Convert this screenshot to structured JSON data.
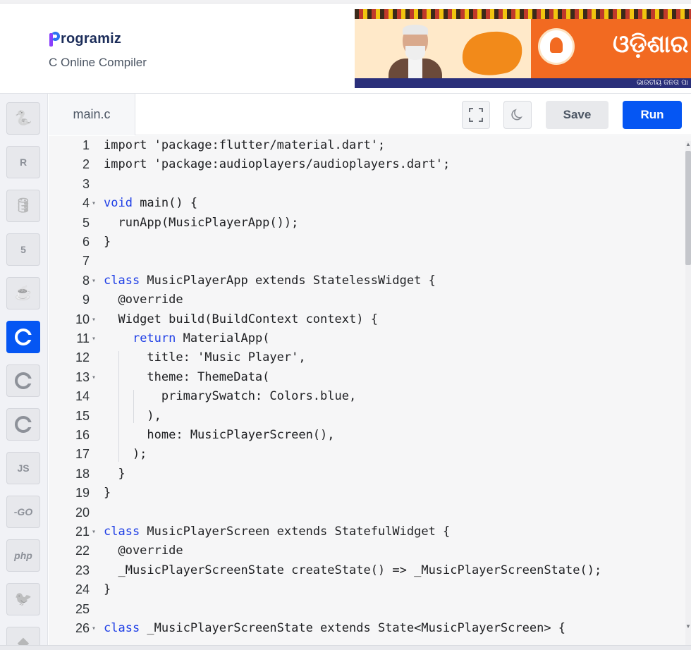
{
  "brand": {
    "name": "Programiz",
    "first_letter": "P",
    "rest": "rogramiz",
    "subtitle": "C Online Compiler"
  },
  "ad": {
    "headline": "ଓଡ଼ିଶାର",
    "footer": "ଭାରତୀୟ ଜନତା ପା"
  },
  "sidebar": {
    "languages": [
      {
        "name": "python",
        "icon": "python-icon",
        "label": "",
        "active": false
      },
      {
        "name": "r",
        "icon": "r-icon",
        "label": "R",
        "active": false
      },
      {
        "name": "sql",
        "icon": "database-icon",
        "label": "",
        "active": false
      },
      {
        "name": "html",
        "icon": "html5-icon",
        "label": "5",
        "active": false
      },
      {
        "name": "java",
        "icon": "java-icon",
        "label": "",
        "active": false
      },
      {
        "name": "c",
        "icon": "c-icon",
        "label": "C",
        "active": true
      },
      {
        "name": "cpp",
        "icon": "cpp-icon",
        "label": "",
        "active": false
      },
      {
        "name": "csharp",
        "icon": "csharp-icon",
        "label": "",
        "active": false
      },
      {
        "name": "javascript",
        "icon": "js-icon",
        "label": "JS",
        "active": false
      },
      {
        "name": "go",
        "icon": "go-icon",
        "label": "-GO",
        "active": false
      },
      {
        "name": "php",
        "icon": "php-icon",
        "label": "php",
        "active": false
      },
      {
        "name": "swift",
        "icon": "swift-icon",
        "label": "",
        "active": false
      },
      {
        "name": "rust",
        "icon": "rust-icon",
        "label": "",
        "active": false
      }
    ]
  },
  "editor": {
    "tab_name": "main.c",
    "save_label": "Save",
    "run_label": "Run",
    "lines": [
      {
        "n": "1",
        "fold": false,
        "code": "import 'package:flutter/material.dart';"
      },
      {
        "n": "2",
        "fold": false,
        "code": "import 'package:audioplayers/audioplayers.dart';"
      },
      {
        "n": "3",
        "fold": false,
        "code": ""
      },
      {
        "n": "4",
        "fold": true,
        "code": "void main() {"
      },
      {
        "n": "5",
        "fold": false,
        "code": "  runApp(MusicPlayerApp());"
      },
      {
        "n": "6",
        "fold": false,
        "code": "}"
      },
      {
        "n": "7",
        "fold": false,
        "code": ""
      },
      {
        "n": "8",
        "fold": true,
        "code": "class MusicPlayerApp extends StatelessWidget {"
      },
      {
        "n": "9",
        "fold": false,
        "code": "  @override"
      },
      {
        "n": "10",
        "fold": true,
        "code": "  Widget build(BuildContext context) {"
      },
      {
        "n": "11",
        "fold": true,
        "code": "    return MaterialApp("
      },
      {
        "n": "12",
        "fold": false,
        "code": "      title: 'Music Player',"
      },
      {
        "n": "13",
        "fold": true,
        "code": "      theme: ThemeData("
      },
      {
        "n": "14",
        "fold": false,
        "code": "        primarySwatch: Colors.blue,"
      },
      {
        "n": "15",
        "fold": false,
        "code": "      ),"
      },
      {
        "n": "16",
        "fold": false,
        "code": "      home: MusicPlayerScreen(),"
      },
      {
        "n": "17",
        "fold": false,
        "code": "    );"
      },
      {
        "n": "18",
        "fold": false,
        "code": "  }"
      },
      {
        "n": "19",
        "fold": false,
        "code": "}"
      },
      {
        "n": "20",
        "fold": false,
        "code": ""
      },
      {
        "n": "21",
        "fold": true,
        "code": "class MusicPlayerScreen extends StatefulWidget {"
      },
      {
        "n": "22",
        "fold": false,
        "code": "  @override"
      },
      {
        "n": "23",
        "fold": false,
        "code": "  _MusicPlayerScreenState createState() => _MusicPlayerScreenState();"
      },
      {
        "n": "24",
        "fold": false,
        "code": "}"
      },
      {
        "n": "25",
        "fold": false,
        "code": ""
      },
      {
        "n": "26",
        "fold": true,
        "code": "class _MusicPlayerScreenState extends State<MusicPlayerScreen> {"
      }
    ]
  },
  "colors": {
    "accent": "#0556f3",
    "keyword": "#1e3ee6",
    "logo_purple": "#8a3ffc"
  }
}
